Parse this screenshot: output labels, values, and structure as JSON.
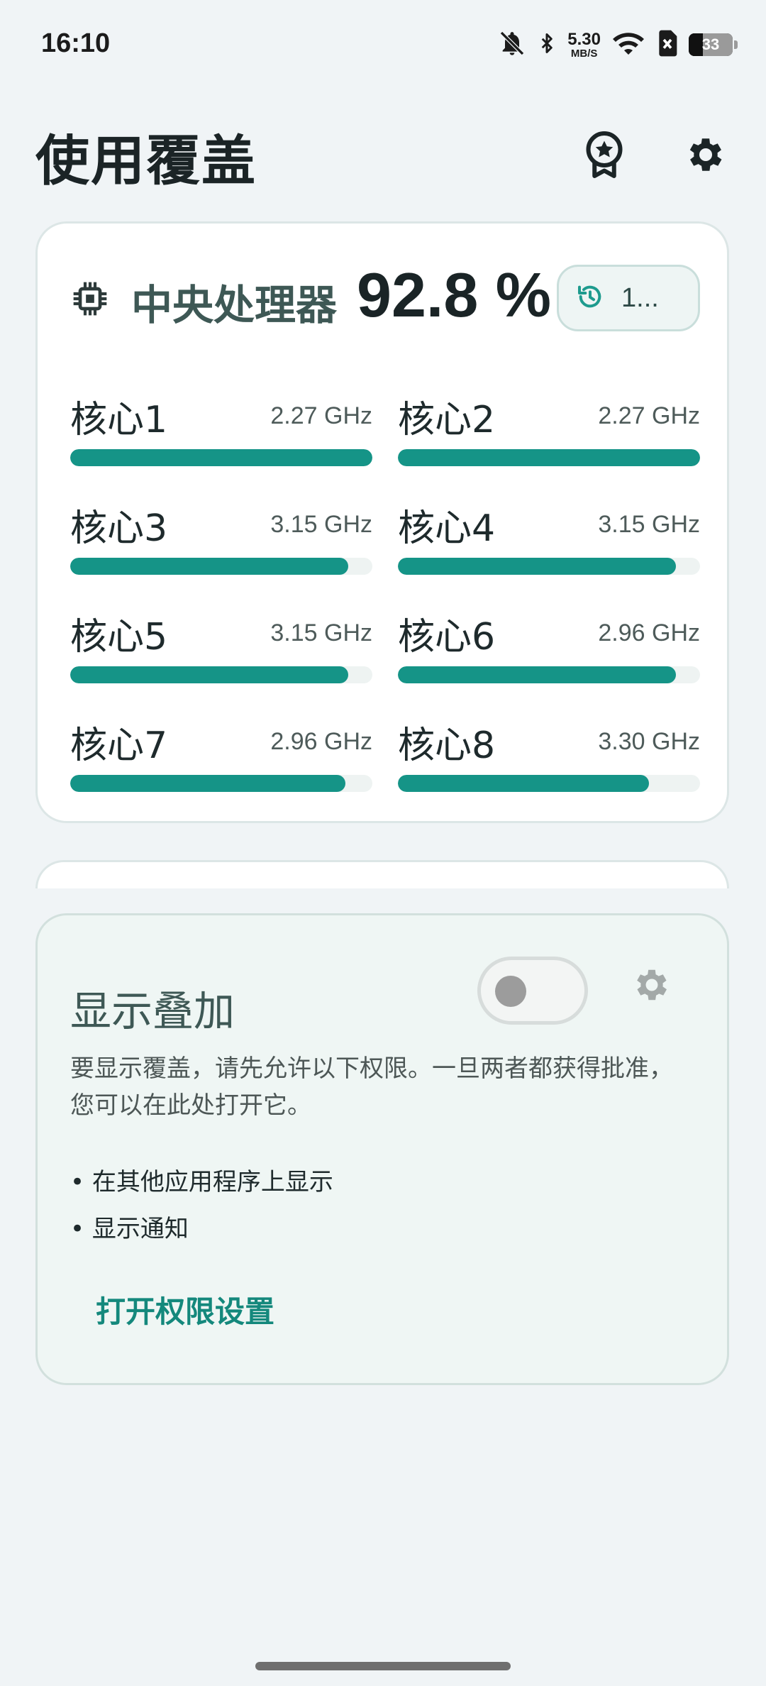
{
  "status_bar": {
    "time": "16:10",
    "net_speed_value": "5.30",
    "net_speed_unit": "MB/S",
    "battery_level": "33",
    "battery_fraction": 0.33,
    "icons": [
      "bell-off-icon",
      "bluetooth-icon",
      "wifi-icon",
      "sim-x-icon",
      "battery-icon"
    ]
  },
  "header": {
    "title": "使用覆盖",
    "icons": [
      "award-icon",
      "settings-gear-icon"
    ]
  },
  "cpu_card": {
    "title": "中央处理器",
    "usage": "92.8 %",
    "history_chip_label": "1...",
    "icons": [
      "cpu-chip-icon",
      "history-icon"
    ],
    "accent_color": "#159487",
    "cores": [
      {
        "name": "核心1",
        "freq": "2.27 GHz",
        "load": 1.0
      },
      {
        "name": "核心2",
        "freq": "2.27 GHz",
        "load": 1.0
      },
      {
        "name": "核心3",
        "freq": "3.15 GHz",
        "load": 0.92
      },
      {
        "name": "核心4",
        "freq": "3.15 GHz",
        "load": 0.92
      },
      {
        "name": "核心5",
        "freq": "3.15 GHz",
        "load": 0.92
      },
      {
        "name": "核心6",
        "freq": "2.96 GHz",
        "load": 0.92
      },
      {
        "name": "核心7",
        "freq": "2.96 GHz",
        "load": 0.91
      },
      {
        "name": "核心8",
        "freq": "3.30 GHz",
        "load": 0.83
      }
    ]
  },
  "overlay_card": {
    "title": "显示叠加",
    "toggle_on": false,
    "description": "要显示覆盖，请先允许以下权限。一旦两者都获得批准，您可以在此处打开它。",
    "permissions": [
      "• 在其他应用程序上显示",
      "• 显示通知"
    ],
    "link_label": "打开权限设置"
  }
}
